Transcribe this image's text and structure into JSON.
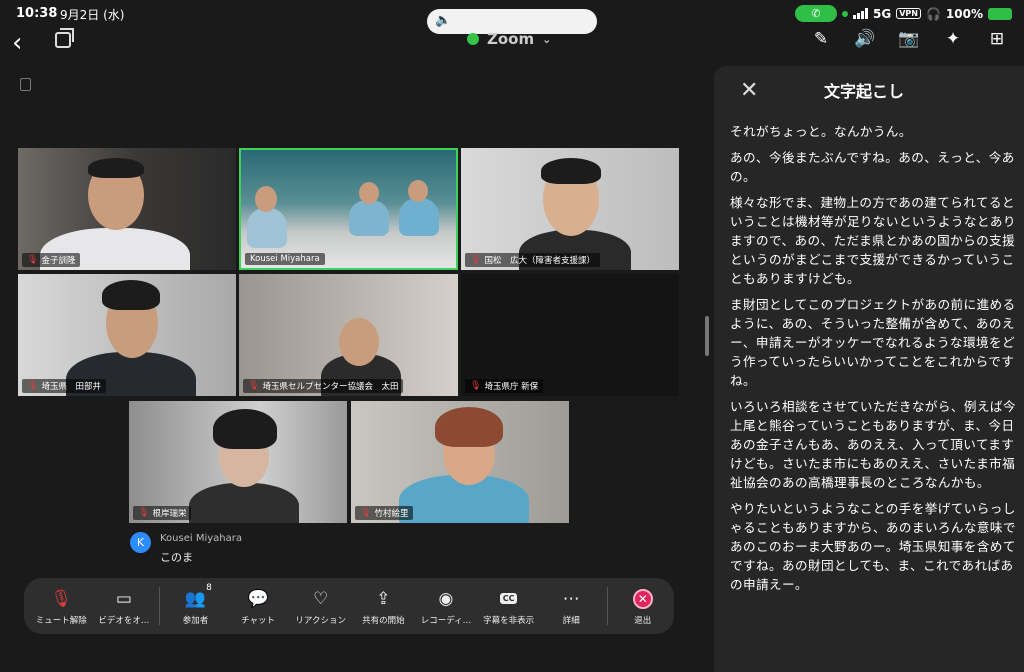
{
  "status": {
    "time": "10:38",
    "date": "9月2日 (水)",
    "network": "5G",
    "vpn": "VPN",
    "battery": "100%"
  },
  "header": {
    "app_title": "Zoom",
    "icons": [
      "sparkle-pen-icon",
      "audio-icon",
      "camera-flip-icon",
      "sparkles-icon",
      "grid-icon"
    ]
  },
  "participants": [
    {
      "name": "金子訓隆",
      "muted": true
    },
    {
      "name": "Kousei Miyahara",
      "muted": false,
      "active_speaker": true
    },
    {
      "name": "国松　広大（障害者支援課）",
      "muted": true
    },
    {
      "name": "埼玉県　田部井",
      "muted": true
    },
    {
      "name": "埼玉県セルプセンター協議会　太田",
      "muted": true
    },
    {
      "name": "埼玉県庁 新保",
      "muted": true
    },
    {
      "name": "根岸瑞栄",
      "muted": true
    },
    {
      "name": "竹村絵里",
      "muted": true
    }
  ],
  "chat": {
    "avatar_initial": "K",
    "sender": "Kousei Miyahara",
    "message": "このま"
  },
  "toolbar": {
    "unmute": "ミュート解除",
    "video": "ビデオをオ…",
    "participants": "参加者",
    "participants_count": "8",
    "chat": "チャット",
    "reactions": "リアクション",
    "share": "共有の開始",
    "record": "レコーディ…",
    "captions": "字幕を非表示",
    "captions_icon": "CC",
    "more": "詳細",
    "leave": "退出"
  },
  "transcript": {
    "title": "文字起こし",
    "paragraphs": [
      "それがちょっと。なんかうん。",
      "あの、今後またぶんですね。あの、えっと、今あの。",
      "様々な形でま、建物上の方であの建てられてるということは機材等が足りないというようなとありますので、あの、ただま県とかあの国からの支援というのがまどこまで支援ができるかっていうこともありますけども。",
      "ま財団としてこのプロジェクトがあの前に進めるように、あの、そういった整備が含めて、あのえー、申請えーがオッケーでなれるような環境をどう作っていったらいいかってことをこれからですね。",
      "いろいろ相談をさせていただきながら、例えば今上尾と熊谷っていうこともありますが、ま、今日あの金子さんもあ、あのええ、入って頂いてますけども。さいたま市にもあのええ、さいたま市福祉協会のあの高橋理事長のところなんかも。",
      "やりたいというようなことの手を挙げていらっしゃることもありますから、あのまいろんな意味であのこのおーま大野あのー。埼玉県知事を含めてですね。あの財団としても、ま、これであればあの申請えー。"
    ]
  }
}
